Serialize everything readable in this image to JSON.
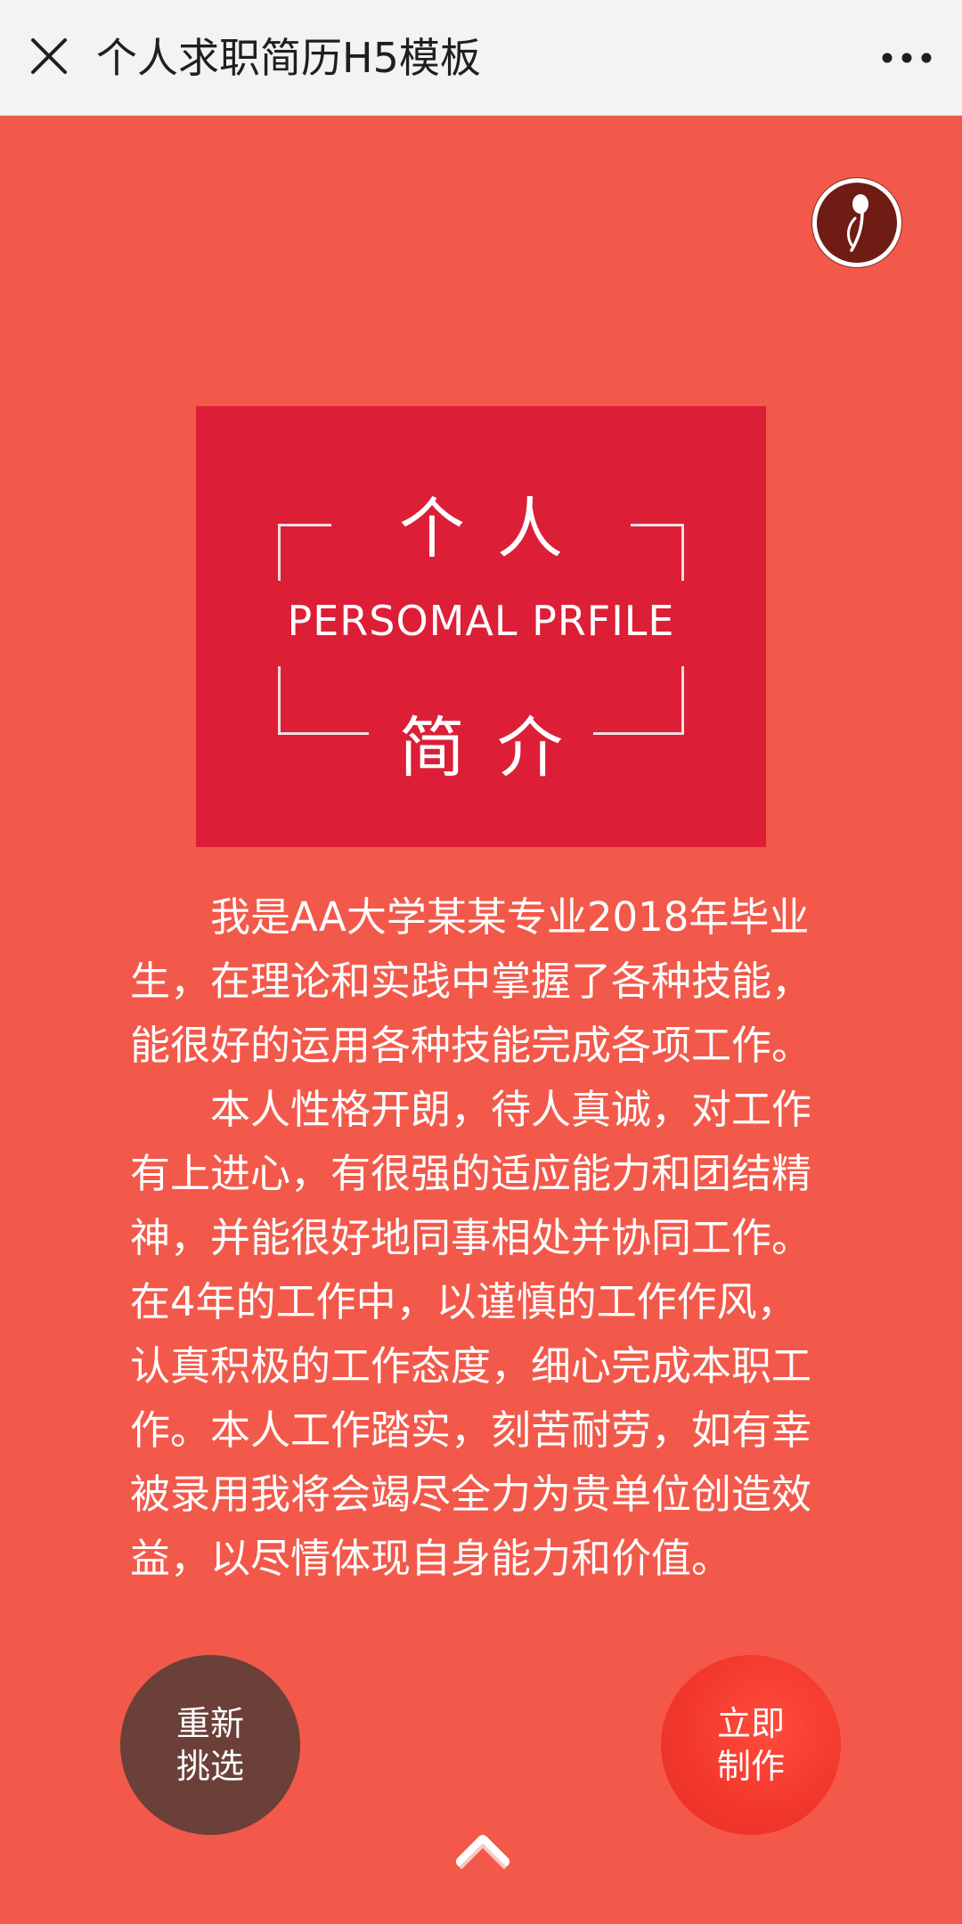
{
  "navbar": {
    "title": "个人求职简历H5模板",
    "close_icon": "close-icon",
    "more_icon": "more-dots-icon"
  },
  "music_icon": "music-note-icon",
  "card": {
    "top_text": "个人",
    "middle_text": "PERSOMAL PRFILE",
    "bottom_text": "简介"
  },
  "bio": {
    "paragraphs": [
      "我是AA大学某某专业2018年毕业生，在理论和实践中掌握了各种技能，能很好的运用各种技能完成各项工作。",
      "本人性格开朗，待人真诚，对工作有上进心，有很强的适应能力和团结精神，并能很好地同事相处并协同工作。在4年的工作中，以谨慎的工作作风，认真积极的工作态度，细心完成本职工作。本人工作踏实，刻苦耐劳，如有幸被录用我将会竭尽全力为贵单位创造效益，以尽情体现自身能力和价值。"
    ]
  },
  "buttons": {
    "reselect_line1": "重新",
    "reselect_line2": "挑选",
    "make_line1": "立即",
    "make_line2": "制作"
  },
  "scroll_up_icon": "chevron-up-icon",
  "colors": {
    "background": "#f2594a",
    "card": "#dd1e37",
    "reselect_button": "#6a4039",
    "make_button": "#f2382c",
    "music_button": "#6e1c14"
  }
}
